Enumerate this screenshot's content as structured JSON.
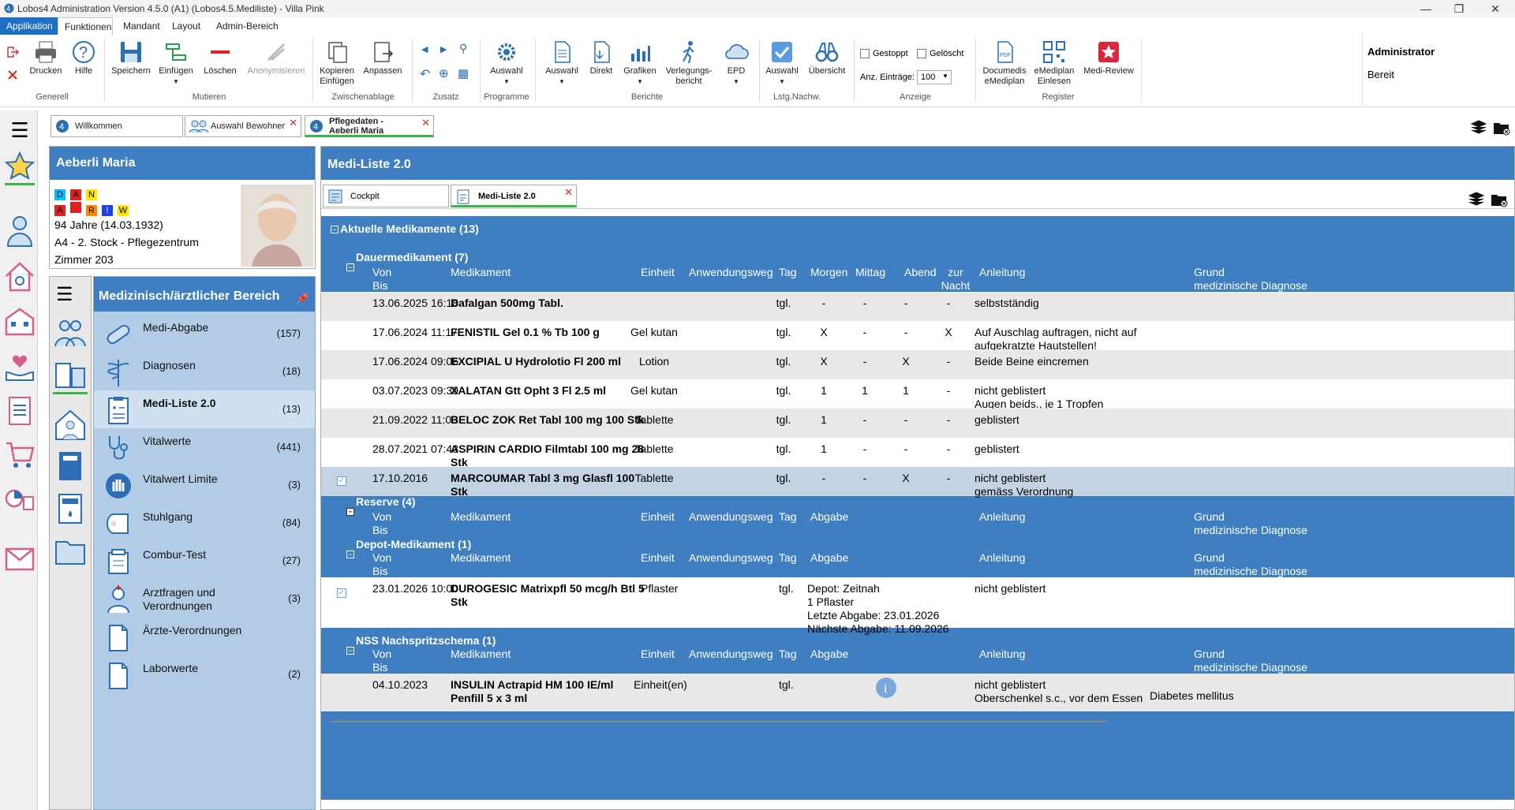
{
  "window": {
    "title": "Lobos4 Administration Version 4.5.0 (A1) (Lobos4.5.Mediliste) - Villa Pink"
  },
  "menu": [
    "Applikation",
    "Funktionen",
    "Mandant",
    "Layout",
    "Admin-Bereich"
  ],
  "ribbon": {
    "buttons": {
      "drucken": "Drucken",
      "hilfe": "Hilfe",
      "speichern": "Speichern",
      "einfuegen": "Einfügen",
      "loeschen": "Löschen",
      "anonymisieren": "Anonymisieren",
      "kopieren": "Kopieren Einfügen",
      "anpassen": "Anpassen",
      "auswahl1": "Auswahl",
      "auswahl2": "Auswahl",
      "direkt": "Direkt",
      "grafiken": "Grafiken",
      "verlauf": "Verlegungs-bericht",
      "epd": "EPD",
      "auswahl3": "Auswahl",
      "uebersicht": "Übersicht",
      "documedis": "Documedis eMediplan",
      "emediplan": "eMediplan Einlesen",
      "medireview": "Medi-Review"
    },
    "groups": {
      "generell": "Generell",
      "mutieren": "Mutieren",
      "zwischenablage": "Zwischenablage",
      "zusatz": "Zusatz",
      "programme": "Programme",
      "berichte": "Berichte",
      "lstg": "Lstg.Nachw.",
      "anzeige": "Anzeige",
      "register": "Register"
    },
    "anzeige": {
      "gestoppt": "Gestoppt",
      "geloescht": "Gelöscht",
      "anz_label": "Anz. Einträge:",
      "anz_value": "100"
    },
    "user": {
      "name": "Administrator",
      "status": "Bereit"
    }
  },
  "tabs": [
    {
      "label": "Willkommen"
    },
    {
      "label": "Auswahl Bewohner"
    },
    {
      "label": "Pflegedaten -\nAeberli Maria"
    }
  ],
  "patient": {
    "name": "Aeberli Maria",
    "badges_row1": [
      "D",
      "A",
      "N"
    ],
    "badges_row2": [
      "A",
      "",
      "R",
      "!",
      "W"
    ],
    "age": "94 Jahre (14.03.1932)",
    "location": "A4 - 2. Stock - Pflegezentrum",
    "room": "Zimmer 203"
  },
  "nav": {
    "header": "Medizinisch/ärztlicher Bereich",
    "items": [
      {
        "label": "Medi-Abgabe",
        "count": "(157)"
      },
      {
        "label": "Diagnosen",
        "count": "(18)"
      },
      {
        "label": "Medi-Liste 2.0",
        "count": "(13)"
      },
      {
        "label": "Vitalwerte",
        "count": "(441)"
      },
      {
        "label": "Vitalwert Limite",
        "count": "(3)"
      },
      {
        "label": "Stuhlgang",
        "count": "(84)"
      },
      {
        "label": "Combur-Test",
        "count": "(27)"
      },
      {
        "label": "Arztfragen und\nVerordnungen",
        "count": "(3)"
      },
      {
        "label": "Ärzte-Verordnungen",
        "count": ""
      },
      {
        "label": "Laborwerte",
        "count": "(2)"
      }
    ]
  },
  "main": {
    "title": "Medi-Liste 2.0",
    "subtabs": [
      "Cockpit",
      "Medi-Liste 2.0"
    ],
    "group_title": "Aktuelle Medikamente (13)",
    "sections": {
      "dauer": "Dauermedikament (7)",
      "reserve": "Reserve (4)",
      "depot": "Depot-Medikament (1)",
      "nss": "NSS Nachspritzschema (1)"
    },
    "headers": {
      "vonbis": "Von\nBis",
      "medikament": "Medikament",
      "einheit": "Einheit",
      "weg": "Anwendungsweg",
      "tag": "Tag",
      "morgen": "Morgen",
      "mittag": "Mittag",
      "abend": "Abend",
      "nacht": "zur\nNacht",
      "anleitung": "Anleitung",
      "grund": "Grund\nmedizinische Diagnose",
      "abgabe": "Abgabe"
    },
    "dauer_rows": [
      {
        "von": "13.06.2025 16:18",
        "med": "Dafalgan 500mg Tabl.",
        "einheit": "",
        "weg": "",
        "tag": "tgl.",
        "morgen": "-",
        "mittag": "-",
        "abend": "-",
        "nacht": "-",
        "anleitung": "selbstständig",
        "grund": ""
      },
      {
        "von": "17.06.2024 11:17",
        "med": "FENISTIL Gel 0.1 % Tb 100 g",
        "einheit": "Gel kutan",
        "weg": "",
        "tag": "tgl.",
        "morgen": "X",
        "mittag": "-",
        "abend": "-",
        "nacht": "X",
        "anleitung": "Auf Auschlag auftragen, nicht auf\naufgekratzte Hautstellen!",
        "grund": ""
      },
      {
        "von": "17.06.2024 09:06",
        "med": "EXCIPIAL U Hydrolotio Fl 200 ml",
        "einheit": "Lotion",
        "weg": "",
        "tag": "tgl.",
        "morgen": "X",
        "mittag": "-",
        "abend": "X",
        "nacht": "-",
        "anleitung": "Beide Beine eincremen",
        "grund": ""
      },
      {
        "von": "03.07.2023 09:39",
        "med": "XALATAN Gtt Opht 3 Fl 2.5 ml",
        "einheit": "Gel kutan",
        "weg": "",
        "tag": "tgl.",
        "morgen": "1",
        "mittag": "1",
        "abend": "1",
        "nacht": "-",
        "anleitung": "nicht geblistert\nAugen beids., je 1 Tropfen",
        "grund": ""
      },
      {
        "von": "21.09.2022 11:00",
        "med": "BELOC ZOK Ret Tabl 100 mg 100 Stk",
        "einheit": "Tablette",
        "weg": "",
        "tag": "tgl.",
        "morgen": "1",
        "mittag": "-",
        "abend": "-",
        "nacht": "-",
        "anleitung": "geblistert",
        "grund": ""
      },
      {
        "von": "28.07.2021 07:43",
        "med": "ASPIRIN CARDIO Filmtabl 100 mg 28\nStk",
        "einheit": "Tablette",
        "weg": "",
        "tag": "tgl.",
        "morgen": "1",
        "mittag": "-",
        "abend": "-",
        "nacht": "-",
        "anleitung": "geblistert",
        "grund": ""
      },
      {
        "von": "17.10.2016",
        "med": "MARCOUMAR Tabl 3 mg Glasfl 100\nStk",
        "einheit": "Tablette",
        "weg": "",
        "tag": "tgl.",
        "morgen": "-",
        "mittag": "-",
        "abend": "X",
        "nacht": "-",
        "anleitung": "nicht geblistert\ngemäss Verordnung",
        "grund": ""
      }
    ],
    "depot_row": {
      "von": "23.01.2026 10:00",
      "med": "DUROGESIC Matrixpfl 50 mcg/h Btl 5\nStk",
      "einheit": "Pflaster",
      "tag": "tgl.",
      "abgabe": "Depot: Zeitnah\n1 Pflaster\nLetzte Abgabe: 23.01.2026\nNächste Abgabe: 11.09.2026",
      "anleitung": "nicht geblistert"
    },
    "nss_row": {
      "von": "04.10.2023",
      "med": "INSULIN Actrapid HM 100 IE/ml\nPenfill 5 x 3 ml",
      "einheit": "Einheit(en)",
      "tag": "tgl.",
      "anleitung": "nicht geblistert\nOberschenkel s.c., vor dem Essen",
      "grund": "Diabetes mellitus"
    }
  },
  "colors": {
    "header_blue": "#3e7ec1",
    "panel_blue": "#b2cce6",
    "selected_row": "#c3d3e3"
  }
}
